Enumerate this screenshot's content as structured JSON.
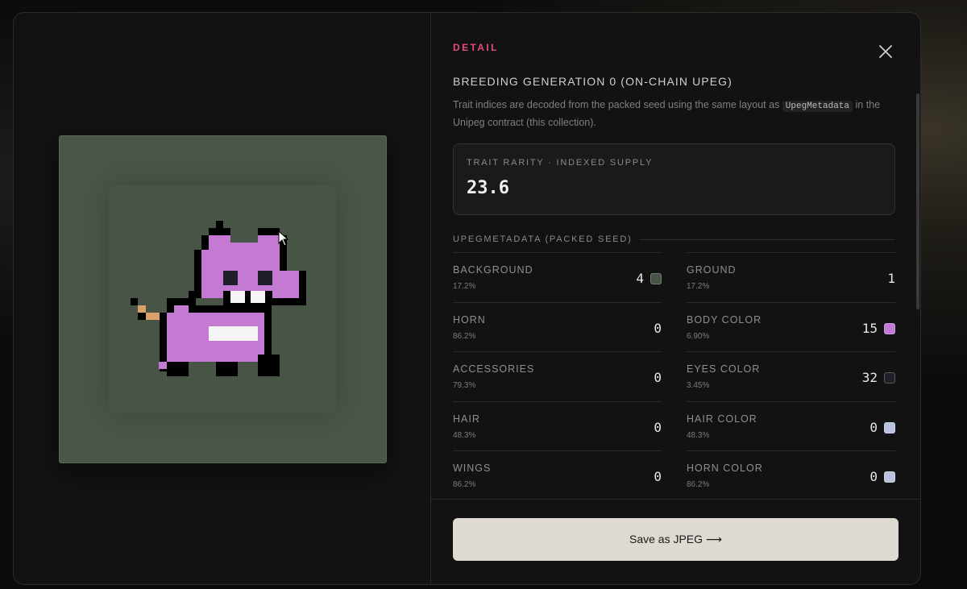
{
  "detail": {
    "eyebrow": "DETAIL",
    "title": "BREEDING GENERATION 0 (ON-CHAIN UPEG)",
    "description_before": "Trait indices are decoded from the packed seed using the same layout as ",
    "description_code": "UpegMetadata",
    "description_after": " in the Unipeg contract (this collection).",
    "close_icon": "close-icon"
  },
  "rarity": {
    "label": "TRAIT RARITY · INDEXED SUPPLY",
    "value": "23.6"
  },
  "section": {
    "heading": "UPEGMETADATA (PACKED SEED)"
  },
  "traits": [
    {
      "name": "BACKGROUND",
      "pct": "17.2%",
      "value": "4",
      "swatch": "#465246"
    },
    {
      "name": "GROUND",
      "pct": "17.2%",
      "value": "1",
      "swatch": null
    },
    {
      "name": "HORN",
      "pct": "86.2%",
      "value": "0",
      "swatch": null
    },
    {
      "name": "BODY COLOR",
      "pct": "6.90%",
      "value": "15",
      "swatch": "#c47ad2"
    },
    {
      "name": "ACCESSORIES",
      "pct": "79.3%",
      "value": "0",
      "swatch": null
    },
    {
      "name": "EYES COLOR",
      "pct": "3.45%",
      "value": "32",
      "swatch": "#1f1f2a"
    },
    {
      "name": "HAIR",
      "pct": "48.3%",
      "value": "0",
      "swatch": null
    },
    {
      "name": "HAIR COLOR",
      "pct": "48.3%",
      "value": "0",
      "swatch": "#b9c2e0"
    },
    {
      "name": "WINGS",
      "pct": "86.2%",
      "value": "0",
      "swatch": null
    },
    {
      "name": "HORN COLOR",
      "pct": "86.2%",
      "value": "0",
      "swatch": "#b9c2e0"
    }
  ],
  "actions": {
    "save_label": "Save as JPEG ⟶"
  },
  "colors": {
    "accent": "#e54b7e",
    "body": "#c47ad2",
    "background": "#475446",
    "button": "#dedad2"
  }
}
